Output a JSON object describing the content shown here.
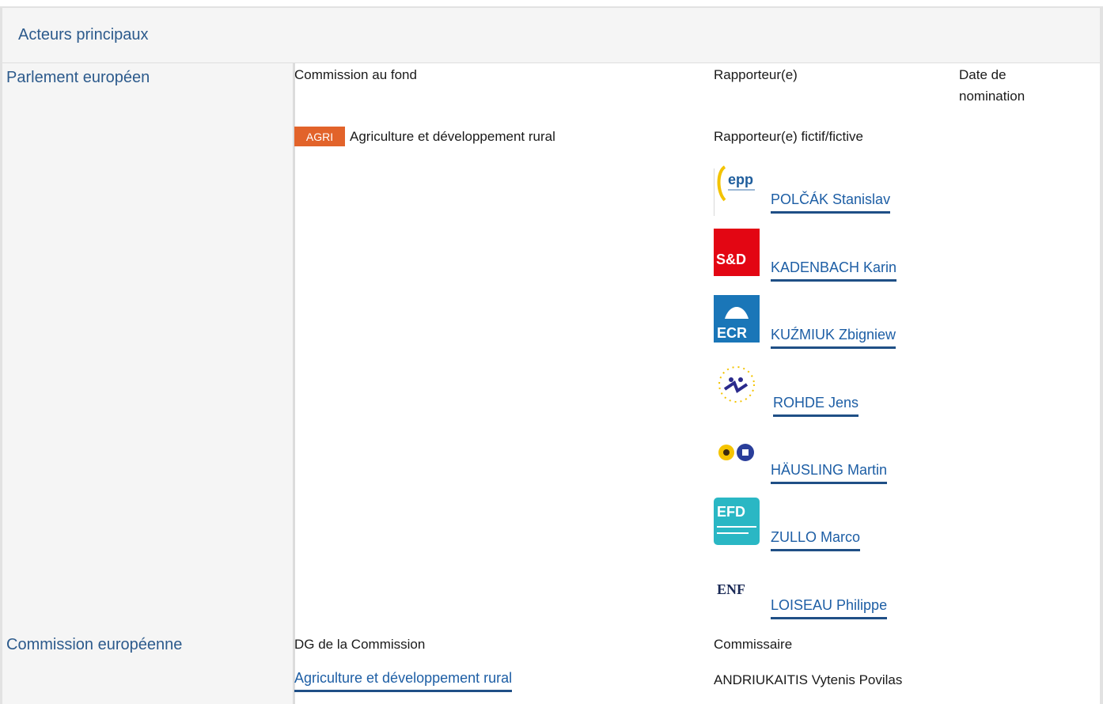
{
  "header": {
    "title": "Acteurs principaux"
  },
  "parlement": {
    "title": "Parlement européen",
    "col_commission": "Commission au fond",
    "col_rapporteur": "Rapporteur(e)",
    "col_date": "Date de nomination",
    "committee_code": "AGRI",
    "committee_name": "Agriculture et développement rural",
    "shadow_label": "Rapporteur(e) fictif/fictive",
    "shadows": [
      {
        "name": "POLČÁK Stanislav",
        "logo": "epp",
        "logo_color": "#1e5d9c"
      },
      {
        "name": "KADENBACH Karin",
        "logo": "S&D",
        "logo_color": "#e30613"
      },
      {
        "name": "KUŹMIUK Zbigniew",
        "logo": "ECR",
        "logo_color": "#1a76b8"
      },
      {
        "name": "ROHDE Jens",
        "logo": "alde-icon",
        "logo_color": "#2a2a8c"
      },
      {
        "name": "HÄUSLING Martin",
        "logo": "greens-icon",
        "logo_color": "#f5c400"
      },
      {
        "name": "ZULLO Marco",
        "logo": "EFD",
        "logo_color": "#2ab7c4"
      },
      {
        "name": "LOISEAU Philippe",
        "logo": "ENF",
        "logo_color": "#1b2a56"
      }
    ]
  },
  "commission": {
    "title": "Commission européenne",
    "col_dg": "DG de la Commission",
    "col_commissaire": "Commissaire",
    "dg_link": "Agriculture et développement rural",
    "commissaire": "ANDRIUKAITIS Vytenis Povilas"
  },
  "colors": {
    "title_blue": "#2c5a8c",
    "link_blue": "#1d5ea5",
    "badge_orange": "#e2632a"
  }
}
